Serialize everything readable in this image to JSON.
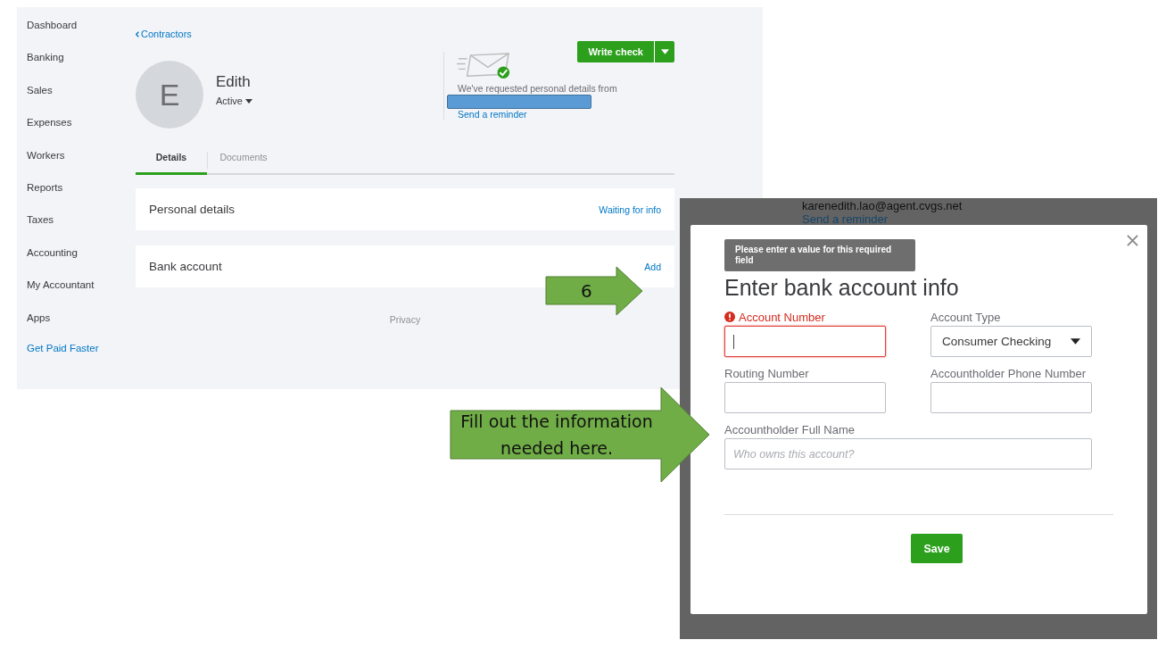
{
  "sidebar": {
    "items": [
      {
        "label": "Dashboard",
        "kind": "nav"
      },
      {
        "label": "Banking",
        "kind": "nav"
      },
      {
        "label": "Sales",
        "kind": "nav"
      },
      {
        "label": "Expenses",
        "kind": "nav"
      },
      {
        "label": "Workers",
        "kind": "nav"
      },
      {
        "label": "Reports",
        "kind": "nav"
      },
      {
        "label": "Taxes",
        "kind": "nav"
      },
      {
        "label": "Accounting",
        "kind": "nav"
      },
      {
        "label": "My Accountant",
        "kind": "nav"
      },
      {
        "label": "Apps",
        "kind": "nav"
      },
      {
        "label": "Get Paid Faster",
        "kind": "promo"
      }
    ]
  },
  "profile": {
    "back_link": "Contractors",
    "initial": "E",
    "name": "Edith",
    "status": "Active",
    "write_check": "Write check",
    "request": {
      "message": "We've requested personal details from",
      "reminder": "Send a reminder"
    }
  },
  "tabs": [
    {
      "label": "Details",
      "selected": true
    },
    {
      "label": "Documents",
      "selected": false
    }
  ],
  "sections": [
    {
      "title": "Personal details",
      "action": "Waiting for info"
    },
    {
      "title": "Bank account",
      "action": "Add"
    }
  ],
  "footer": "Privacy",
  "dialog": {
    "behind_email": "karenedith.lao@agent.cvgs.net",
    "behind_reminder": "Send a reminder",
    "title": "Enter bank account info",
    "tooltip": "Please enter a value for this required field",
    "fields": [
      {
        "label": "Account Number",
        "kind": "text",
        "error": true,
        "focused": true
      },
      {
        "label": "Account Type",
        "kind": "select",
        "value": "Consumer Checking",
        "error": false,
        "focused": false
      },
      {
        "label": "Routing Number",
        "kind": "text",
        "error": false,
        "focused": false
      },
      {
        "label": "Accountholder Phone Number",
        "kind": "text",
        "error": false,
        "focused": false
      },
      {
        "label": "Accountholder Full Name",
        "kind": "wide",
        "placeholder": "Who owns this account?",
        "error": false,
        "focused": false
      }
    ],
    "save": "Save"
  },
  "callouts": [
    {
      "text": "6"
    },
    {
      "text": "Fill out the information needed here."
    }
  ]
}
